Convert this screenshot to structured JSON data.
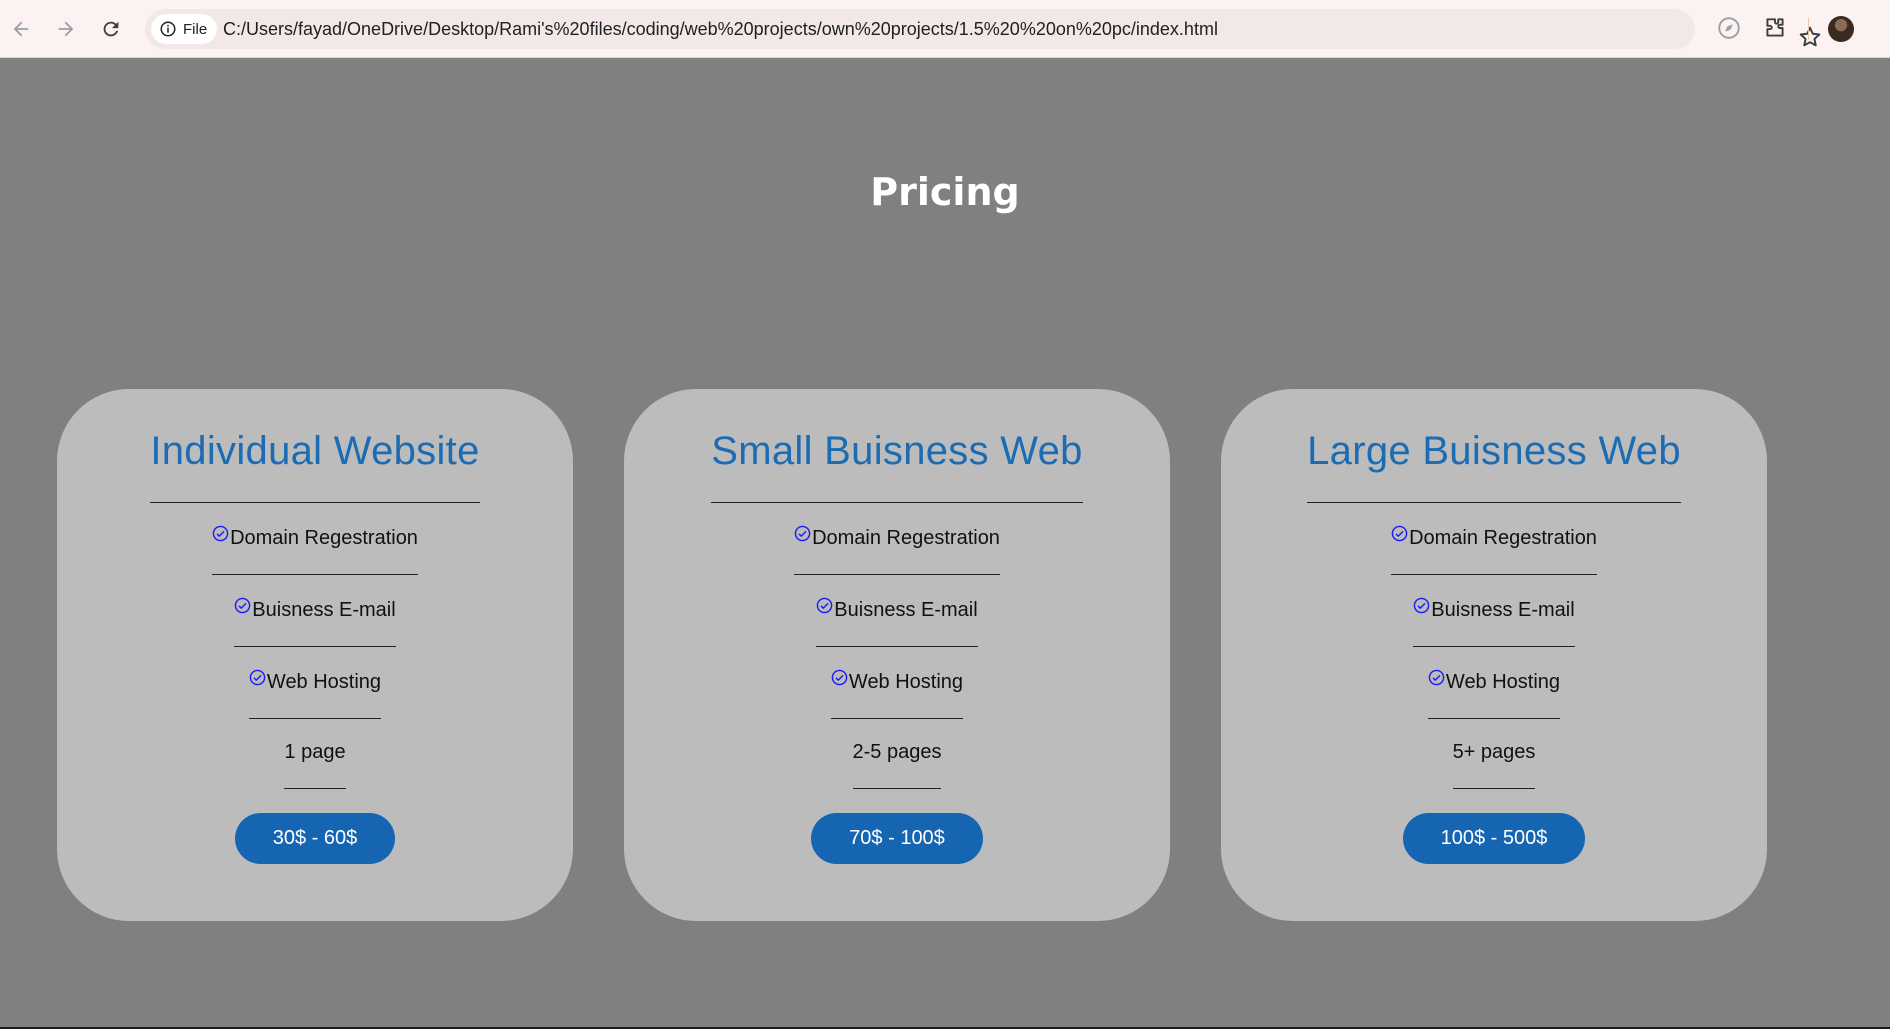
{
  "browser": {
    "scheme_label": "File",
    "url": "C:/Users/fayad/OneDrive/Desktop/Rami's%20files/coding/web%20projects/own%20projects/1.5%20%20on%20pc/index.html",
    "icons": [
      "back-arrow-icon",
      "forward-arrow-icon",
      "reload-icon",
      "info-icon",
      "star-icon",
      "compass-icon",
      "extensions-icon",
      "profile-avatar"
    ]
  },
  "page": {
    "title": "Pricing"
  },
  "colors": {
    "background": "#808080",
    "card": "#bcbcbc",
    "card_title": "#1c6cb4",
    "button": "#1565b2",
    "check": "#1a1aff"
  },
  "plans": [
    {
      "title": "Individual Website",
      "features": [
        "Domain Regestration",
        "Buisness E-mail",
        "Web Hosting"
      ],
      "pages": "1 page",
      "price": "30$ - 60$"
    },
    {
      "title": "Small Buisness Web",
      "features": [
        "Domain Regestration",
        "Buisness E-mail",
        "Web Hosting"
      ],
      "pages": "2-5 pages",
      "price": "70$ - 100$"
    },
    {
      "title": "Large Buisness Web",
      "features": [
        "Domain Regestration",
        "Buisness E-mail",
        "Web Hosting"
      ],
      "pages": "5+ pages",
      "price": "100$ - 500$"
    }
  ]
}
